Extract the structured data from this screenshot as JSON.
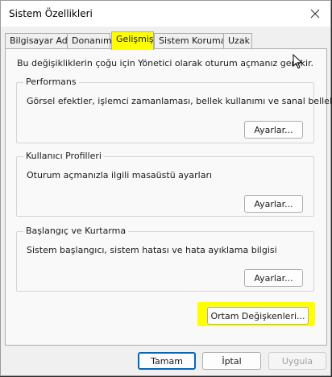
{
  "window": {
    "title": "Sistem Özellikleri"
  },
  "tabs": [
    {
      "label": "Bilgisayar Adı",
      "active": false
    },
    {
      "label": "Donanım",
      "active": false
    },
    {
      "label": "Gelişmiş",
      "active": true
    },
    {
      "label": "Sistem Koruması",
      "active": false
    },
    {
      "label": "Uzak",
      "active": false
    }
  ],
  "info_text": "Bu değişikliklerin çoğu için Yönetici olarak oturum açmanız gerekir.",
  "groups": {
    "performance": {
      "label": "Performans",
      "description": "Görsel efektler, işlemci zamanlaması, bellek kullanımı ve sanal bellek",
      "button": "Ayarlar..."
    },
    "user_profiles": {
      "label": "Kullanıcı Profilleri",
      "description": "Oturum açmanızla ilgili masaüstü ayarları",
      "button": "Ayarlar..."
    },
    "startup_recovery": {
      "label": "Başlangıç ve Kurtarma",
      "description": "Sistem başlangıcı, sistem hatası ve hata ayıklama bilgisi",
      "button": "Ayarlar..."
    }
  },
  "env_button": "Ortam Değişkenleri...",
  "footer": {
    "ok": "Tamam",
    "cancel": "İptal",
    "apply": "Uygula"
  },
  "colors": {
    "highlight": "#ffff00",
    "focus_border": "#0067c0"
  },
  "icons": {
    "close": "close-icon",
    "cursor": "mouse-cursor-icon"
  }
}
